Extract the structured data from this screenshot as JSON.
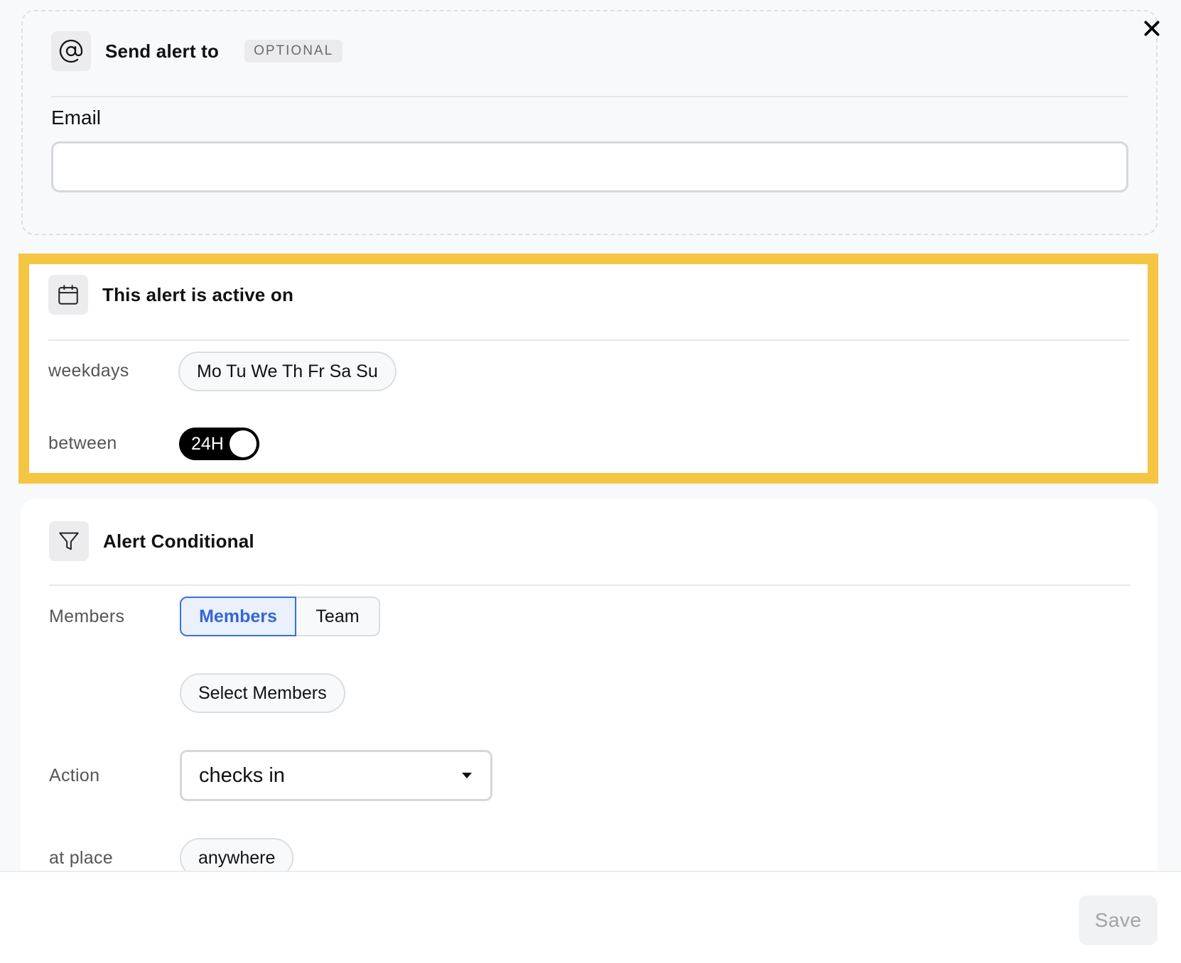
{
  "send_alert": {
    "title": "Send alert to",
    "badge": "OPTIONAL",
    "email_label": "Email",
    "email_value": "",
    "email_placeholder": ""
  },
  "active_on": {
    "title": "This alert is active on",
    "weekdays_label": "weekdays",
    "weekdays_value": "Mo Tu We Th Fr Sa Su",
    "between_label": "between",
    "toggle_label": "24H",
    "toggle_on": true,
    "highlight_color": "#f5c544"
  },
  "conditional": {
    "title": "Alert Conditional",
    "members_label": "Members",
    "segments": [
      "Members",
      "Team"
    ],
    "selected_segment": "Members",
    "select_members_label": "Select Members",
    "action_label": "Action",
    "action_value": "checks in",
    "at_place_label": "at place",
    "at_place_value": "anywhere"
  },
  "footer": {
    "save_label": "Save",
    "save_enabled": false
  },
  "icons": {
    "close": "close-icon",
    "at": "at-sign-icon",
    "calendar": "calendar-icon",
    "filter": "filter-icon",
    "dropdown": "caret-down-icon"
  },
  "colors": {
    "accent": "#3467d4",
    "accent_bg": "#eaf0fc",
    "toggle_bg": "#000000"
  }
}
